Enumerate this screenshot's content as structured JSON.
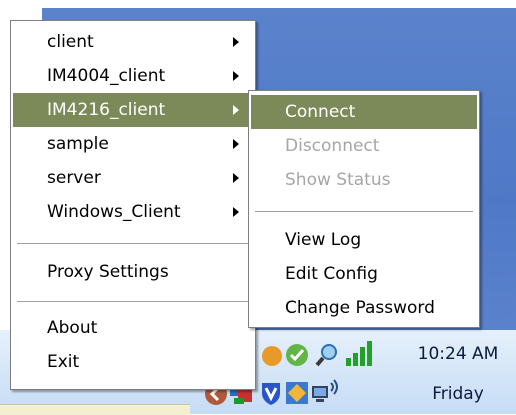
{
  "main_menu": {
    "items": [
      {
        "label": "client",
        "submenu": true
      },
      {
        "label": "IM4004_client",
        "submenu": true
      },
      {
        "label": "IM4216_client",
        "submenu": true,
        "highlighted": true
      },
      {
        "label": "sample",
        "submenu": true
      },
      {
        "label": "server",
        "submenu": true
      },
      {
        "label": "Windows_Client",
        "submenu": true
      }
    ],
    "proxy_label": "Proxy Settings",
    "about_label": "About",
    "exit_label": "Exit"
  },
  "submenu": {
    "connect_label": "Connect",
    "disconnect_label": "Disconnect",
    "show_status_label": "Show Status",
    "view_log_label": "View Log",
    "edit_config_label": "Edit Config",
    "change_password_label": "Change Password"
  },
  "taskbar": {
    "time": "10:24 AM",
    "day": "Friday"
  },
  "colors": {
    "highlight": "#7c8a5a",
    "disabled_text": "#a6a6a6",
    "desktop_blue": "#4f79c6"
  }
}
